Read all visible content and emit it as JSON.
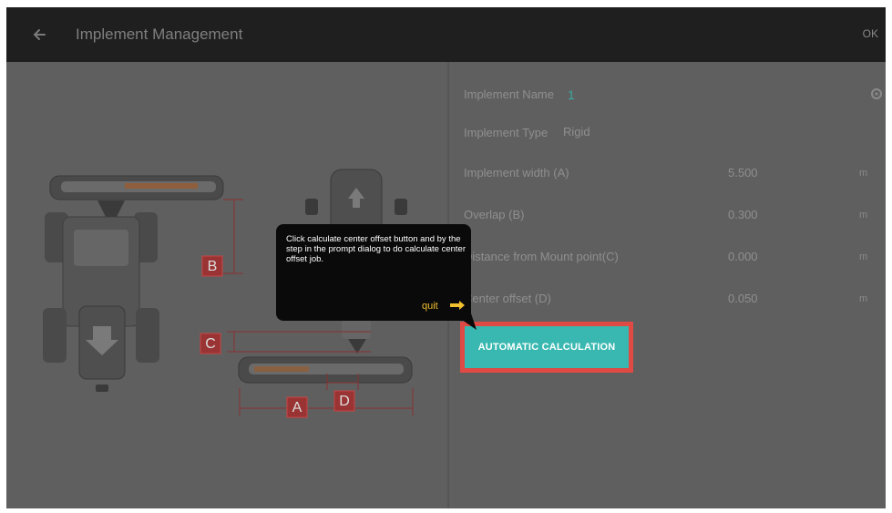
{
  "header": {
    "title": "Implement Management",
    "ok_label": "OK"
  },
  "form": {
    "name_label": "Implement Name",
    "name_value": "1",
    "type_label": "Implement Type",
    "type_value": "Rigid",
    "rows": [
      {
        "label": "Implement width (A)",
        "value": "5.500",
        "unit": "m"
      },
      {
        "label": "Overlap (B)",
        "value": "0.300",
        "unit": "m"
      },
      {
        "label": "Distance from Mount point(C)",
        "value": "0.000",
        "unit": "m"
      },
      {
        "label": "Center offset (D)",
        "value": "0.050",
        "unit": "m"
      }
    ],
    "auto_button": "AUTOMATIC CALCULATION"
  },
  "diagram": {
    "label_a": "A",
    "label_b": "B",
    "label_c": "C",
    "label_d": "D"
  },
  "tooltip": {
    "text": "Click calculate center offset button and by the step in the prompt dialog to do calculate center offset job.",
    "quit_label": "quit"
  },
  "colors": {
    "header_bg": "#1f1f1f",
    "overlay": "#5f5f5f",
    "accent_teal": "#38b8b0",
    "highlight_red": "#e04a44",
    "label_red": "#a03a3a"
  }
}
